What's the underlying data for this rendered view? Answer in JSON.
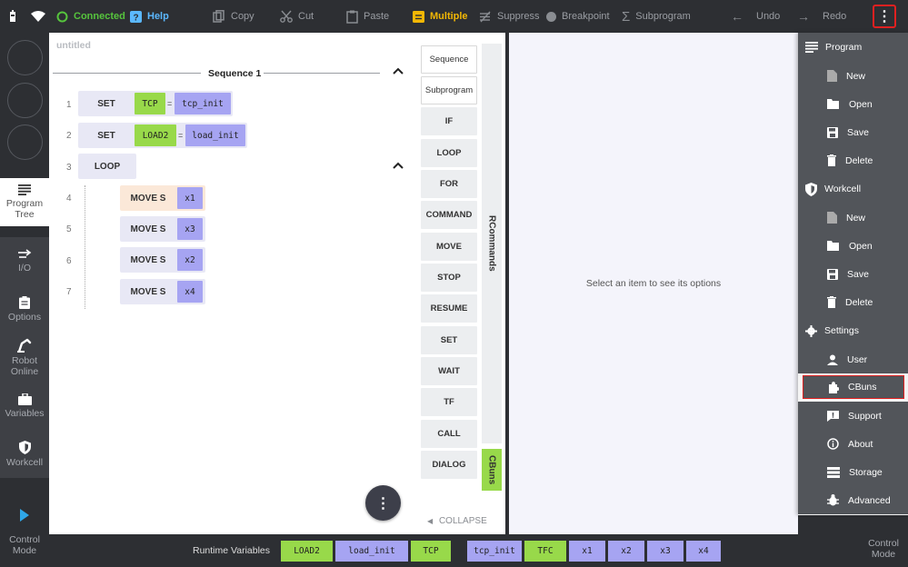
{
  "topbar": {
    "connected": "Connected",
    "help": "Help",
    "copy": "Copy",
    "cut": "Cut",
    "paste": "Paste",
    "multiple": "Multiple",
    "suppress": "Suppress",
    "breakpoint": "Breakpoint",
    "subprogram": "Subprogram",
    "undo": "Undo",
    "redo": "Redo",
    "menu_icon": "⋮"
  },
  "leftnav": {
    "items": [
      {
        "label": "Program Tree"
      },
      {
        "label": "I/O"
      },
      {
        "label": "Options"
      },
      {
        "label": "Robot Online"
      },
      {
        "label": "Variables"
      },
      {
        "label": "Workcell"
      }
    ],
    "control_mode": "Control Mode"
  },
  "program": {
    "title": "untitled",
    "sequence_label": "Sequence 1",
    "rows": [
      {
        "num": "1",
        "cmd": "SET",
        "var": "TCP",
        "eq": "=",
        "val": "tcp_init"
      },
      {
        "num": "2",
        "cmd": "SET",
        "var": "LOAD2",
        "eq": "=",
        "val": "load_init"
      },
      {
        "num": "3",
        "cmd": "LOOP"
      },
      {
        "num": "4",
        "cmd": "MOVE S",
        "val": "x1"
      },
      {
        "num": "5",
        "cmd": "MOVE S",
        "val": "x3"
      },
      {
        "num": "6",
        "cmd": "MOVE S",
        "val": "x2"
      },
      {
        "num": "7",
        "cmd": "MOVE S",
        "val": "x4"
      }
    ],
    "fab_icon": "⋮"
  },
  "commands": {
    "items": [
      "Sequence",
      "Subprogram",
      "IF",
      "LOOP",
      "FOR",
      "COMMAND",
      "MOVE",
      "STOP",
      "RESUME",
      "SET",
      "WAIT",
      "TF",
      "CALL",
      "DIALOG"
    ],
    "tab_rcommands": "RCommands",
    "tab_cbuns": "CBuns",
    "collapse": "COLLAPSE"
  },
  "options": {
    "placeholder": "Select an item to see its options"
  },
  "drawer": {
    "program": {
      "title": "Program",
      "items": [
        "New",
        "Open",
        "Save",
        "Delete"
      ]
    },
    "workcell": {
      "title": "Workcell",
      "items": [
        "New",
        "Open",
        "Save",
        "Delete"
      ]
    },
    "settings": {
      "title": "Settings",
      "items": [
        "User",
        "CBuns",
        "Support",
        "About",
        "Storage",
        "Advanced"
      ]
    }
  },
  "runtime": {
    "label": "Runtime Variables",
    "vars": [
      {
        "text": "LOAD2",
        "color": "green"
      },
      {
        "text": "load_init",
        "color": "purple"
      },
      {
        "text": "TCP",
        "color": "green"
      },
      {
        "text": "tcp_init",
        "color": "purple"
      },
      {
        "text": "TFC",
        "color": "green"
      },
      {
        "text": "x1",
        "color": "purple"
      },
      {
        "text": "x2",
        "color": "purple"
      },
      {
        "text": "x3",
        "color": "purple"
      },
      {
        "text": "x4",
        "color": "purple"
      }
    ]
  },
  "colors": {
    "accent_green": "#98d94a",
    "accent_purple": "#a6a4f2",
    "connected_green": "#56c43d",
    "multiple_yellow": "#f2b705",
    "help_blue": "#5bb8ff",
    "highlight_red": "#e02020"
  }
}
